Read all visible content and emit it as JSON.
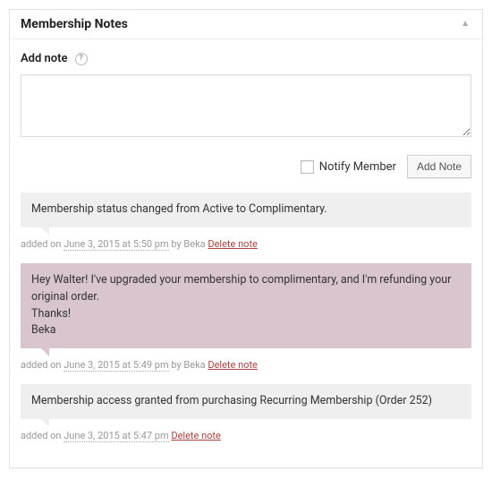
{
  "panel": {
    "title": "Membership Notes"
  },
  "add_note": {
    "label": "Add note",
    "notify_label": "Notify Member",
    "button_label": "Add Note"
  },
  "notes": [
    {
      "type": "system",
      "content": "Membership status changed from Active to Complimentary.",
      "meta_prefix": "added on ",
      "date": "June 3, 2015 at 5:50 pm",
      "by_text": " by Beka ",
      "delete_label": "Delete note"
    },
    {
      "type": "customer",
      "content": "Hey Walter! I've upgraded your membership to complimentary, and I'm refunding your original order.\nThanks!\nBeka",
      "meta_prefix": "added on ",
      "date": "June 3, 2015 at 5:49 pm",
      "by_text": " by Beka ",
      "delete_label": "Delete note"
    },
    {
      "type": "system",
      "content": "Membership access granted from purchasing Recurring Membership (Order 252)",
      "meta_prefix": "added on ",
      "date": "June 3, 2015 at 5:47 pm",
      "by_text": " ",
      "delete_label": "Delete note"
    }
  ]
}
